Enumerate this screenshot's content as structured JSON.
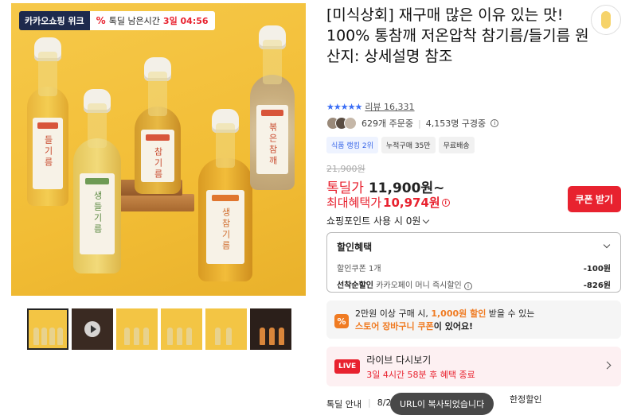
{
  "hero": {
    "brand_badge": "카카오쇼핑 위크",
    "timer_prefix": "톡딜 남은시간",
    "timer_value": "3일 04:56",
    "bottle_labels": [
      "들기름",
      "생들기름",
      "참기름",
      "생참기름",
      "볶은참깨"
    ]
  },
  "thumbnails": [
    {
      "type": "image",
      "active": true
    },
    {
      "type": "video",
      "active": false
    },
    {
      "type": "image",
      "active": false
    },
    {
      "type": "image",
      "active": false
    },
    {
      "type": "image",
      "active": false
    },
    {
      "type": "image",
      "active": false
    }
  ],
  "product": {
    "title": "[미식상회] 재구매 많은 이유 있는 맛! 100% 통참깨 저온압착 참기름/들기름 원산지: 상세설명 참조",
    "stars": "★★★★★",
    "review_label": "리뷰 16,331",
    "order_count": "629개 주문중",
    "followers": "4,153명 구경중",
    "chips": [
      "식품 랭킹 2위",
      "누적구매 35만",
      "무료배송"
    ],
    "original_price": "21,900원",
    "deal_label": "톡딜가",
    "deal_price": "11,900원~",
    "max_label": "최대혜택가",
    "max_price": "10,974원",
    "coupon_button": "쿠폰 받기",
    "point_text": "쇼핑포인트 사용 시 0원"
  },
  "discount": {
    "title": "할인혜택",
    "lines": [
      {
        "name": "할인쿠폰 1개",
        "desc": "",
        "value": "-100원"
      },
      {
        "name": "선착순할인",
        "desc": "카카오페이 머니 즉시할인",
        "value": "-826원"
      }
    ]
  },
  "promo": {
    "icon": "%",
    "line1_a": "2만원 이상 구매 시, ",
    "line1_red": "1,000원 할인",
    "line1_b": " 받을 수 있는",
    "line2_red": "스토어 장바구니 쿠폰",
    "line2_b": "이 있어요!"
  },
  "live": {
    "tag": "LIVE",
    "title": "라이브 다시보기",
    "subtitle": "3일 4시간 58분 후 혜택 종료"
  },
  "footer": {
    "notice_label": "톡딜 안내",
    "notice_date": "8/2",
    "notice_tail": "한정할인",
    "toast": "URL이 복사되었습니다"
  }
}
